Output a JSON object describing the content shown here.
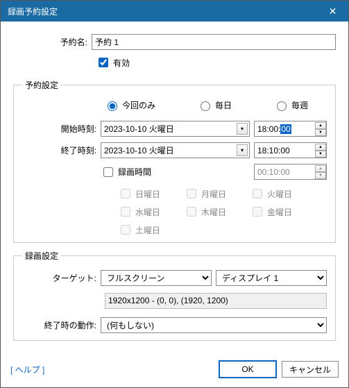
{
  "window": {
    "title": "録画予約設定"
  },
  "name": {
    "label": "予約名:",
    "value": "予約 1"
  },
  "enabled": {
    "label": "有効",
    "checked": true
  },
  "schedule": {
    "legend": "予約設定",
    "recurrence": {
      "once": "今回のみ",
      "daily": "毎日",
      "weekly": "毎週",
      "selected": "once"
    },
    "start": {
      "label": "開始時刻:",
      "date": "2023-10-10 火曜日",
      "time_prefix": "18:00:",
      "time_sel": "00"
    },
    "end": {
      "label": "終了時刻:",
      "date": "2023-10-10 火曜日",
      "time": "18:10:00"
    },
    "duration": {
      "label": "録画時間",
      "value": "00:10:00",
      "checked": false
    },
    "weekdays": {
      "sun": "日曜日",
      "mon": "月曜日",
      "tue": "火曜日",
      "wed": "水曜日",
      "thu": "木曜日",
      "fri": "金曜日",
      "sat": "土曜日"
    }
  },
  "record": {
    "legend": "録画設定",
    "target": {
      "label": "ターゲット:",
      "value": "フルスクリーン",
      "display": "ディスプレイ 1"
    },
    "resolution": "1920x1200 - (0, 0), (1920, 1200)",
    "onend": {
      "label": "終了時の動作:",
      "value": "(何もしない)"
    }
  },
  "footer": {
    "help": "[ ヘルプ ]",
    "ok": "OK",
    "cancel": "キャンセル"
  }
}
